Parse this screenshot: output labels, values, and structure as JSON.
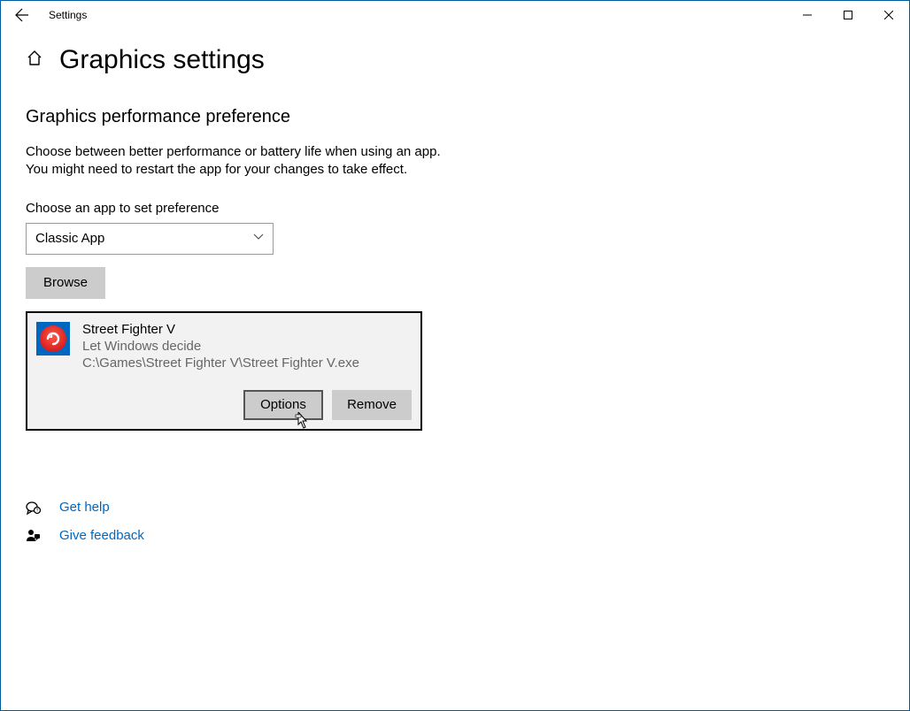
{
  "window": {
    "title": "Settings"
  },
  "page": {
    "title": "Graphics settings"
  },
  "section": {
    "heading": "Graphics performance preference",
    "desc_line1": "Choose between better performance or battery life when using an app.",
    "desc_line2": "You might need to restart the app for your changes to take effect."
  },
  "selector": {
    "label": "Choose an app to set preference",
    "value": "Classic App"
  },
  "browse": {
    "label": "Browse"
  },
  "app": {
    "name": "Street Fighter V",
    "preference": "Let Windows decide",
    "path": "C:\\Games\\Street Fighter V\\Street Fighter V.exe",
    "options_label": "Options",
    "remove_label": "Remove"
  },
  "links": {
    "help": "Get help",
    "feedback": "Give feedback"
  }
}
